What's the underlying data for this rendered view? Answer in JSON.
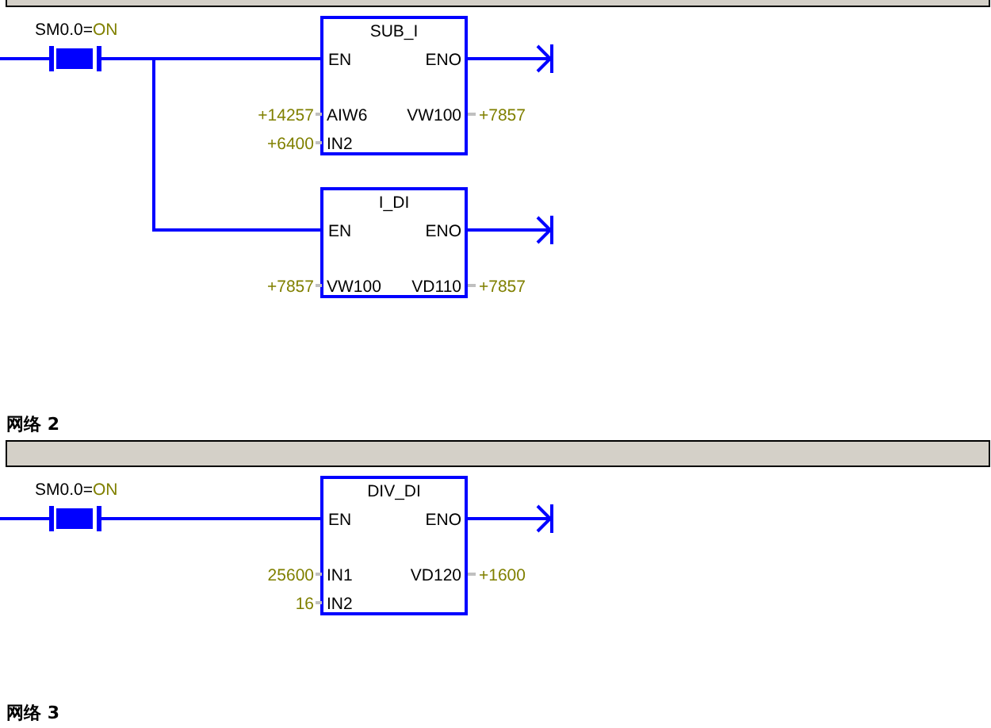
{
  "networks": [
    {
      "rung": {
        "contact": {
          "label": "SM0.0=",
          "state": "ON",
          "energized": true
        },
        "boxes": [
          {
            "name": "SUB_I",
            "en": "EN",
            "eno": "ENO",
            "inputs": [
              {
                "value": "+14257",
                "pin": "AIW6"
              },
              {
                "value": "+6400",
                "pin": "IN2"
              }
            ],
            "outputs": [
              {
                "pin": "VW100",
                "value": "+7857"
              }
            ]
          },
          {
            "name": "I_DI",
            "en": "EN",
            "eno": "ENO",
            "inputs": [
              {
                "value": "+7857",
                "pin": "VW100"
              }
            ],
            "outputs": [
              {
                "pin": "VD110",
                "value": "+7857"
              }
            ]
          }
        ]
      }
    },
    {
      "title": "网络 2",
      "rung": {
        "contact": {
          "label": "SM0.0=",
          "state": "ON",
          "energized": true
        },
        "boxes": [
          {
            "name": "DIV_DI",
            "en": "EN",
            "eno": "ENO",
            "inputs": [
              {
                "value": "25600",
                "pin": "IN1"
              },
              {
                "value": "16",
                "pin": "IN2"
              }
            ],
            "outputs": [
              {
                "pin": "VD120",
                "value": "+1600"
              }
            ]
          }
        ]
      }
    },
    {
      "title": "网络 3"
    }
  ]
}
